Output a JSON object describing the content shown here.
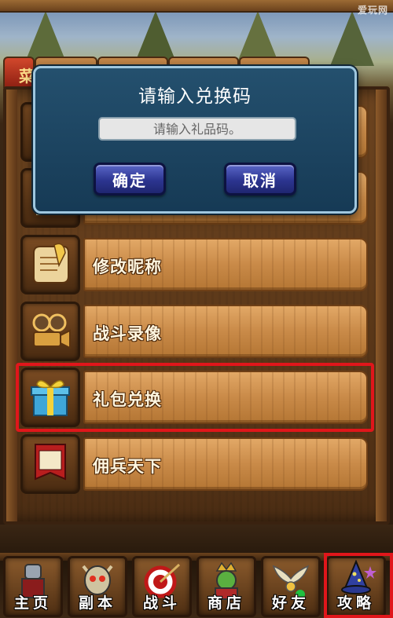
{
  "watermark": "爱玩网",
  "tabs": {
    "active_label": "菜"
  },
  "dialog": {
    "title": "请输入兑换码",
    "input_placeholder": "请输入礼品码。",
    "confirm_label": "确定",
    "cancel_label": "取消"
  },
  "menu": {
    "items": [
      {
        "label": "",
        "icon": "hidden-item-icon"
      },
      {
        "label": "",
        "icon": "scroll-book-icon"
      },
      {
        "label": "修改昵称",
        "icon": "scroll-quill-icon"
      },
      {
        "label": "战斗录像",
        "icon": "film-camera-icon"
      },
      {
        "label": "礼包兑换",
        "icon": "gift-box-icon"
      },
      {
        "label": "佣兵天下",
        "icon": "banner-icon",
        "banner_text": "佣兵天下"
      }
    ],
    "highlighted_index": 4,
    "highlight_color": "#e0161b"
  },
  "bottom_nav": {
    "items": [
      {
        "label": "主页",
        "icon": "knight-icon"
      },
      {
        "label": "副本",
        "icon": "skull-icon"
      },
      {
        "label": "战斗",
        "icon": "target-icon"
      },
      {
        "label": "商店",
        "icon": "merchant-icon"
      },
      {
        "label": "好友",
        "icon": "wings-icon"
      },
      {
        "label": "攻略",
        "icon": "wizard-icon"
      }
    ],
    "highlighted_index": 5
  },
  "colors": {
    "dialog_bg": "#1e4663",
    "button_blue": "#2c3590",
    "plank": "#d39650",
    "highlight": "#e0161b"
  }
}
